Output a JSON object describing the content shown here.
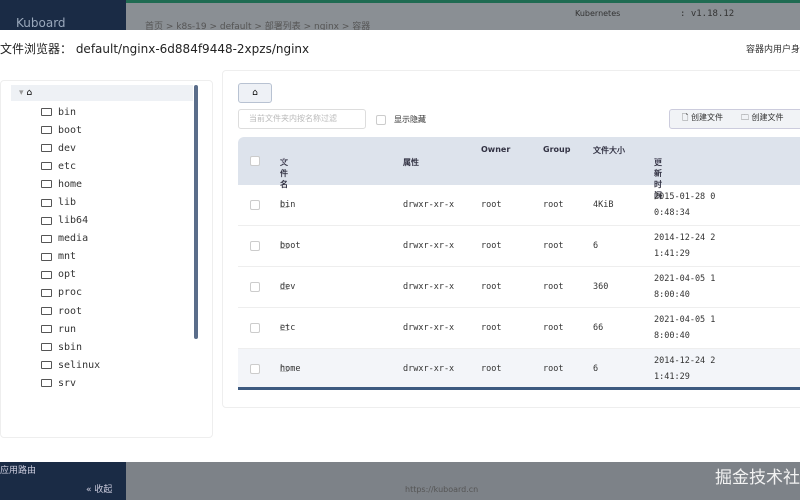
{
  "background": {
    "brand": "Kuboard",
    "breadcrumb": "首页 > k8s-19 > default > 部署列表 > nginx > 容器",
    "versions": [
      {
        "label": "Kubernetes",
        "value": ": v1.18.12"
      }
    ],
    "sidebar_item": "应用路由",
    "collapse": "« 收起",
    "url": "https://kuboard.cn",
    "watermark": "掘金技术社"
  },
  "dialog": {
    "title": "文件浏览器： default/nginx-6d884f9448-2xpzs/nginx",
    "right_label": "容器内用户身"
  },
  "tree": {
    "items": [
      "bin",
      "boot",
      "dev",
      "etc",
      "home",
      "lib",
      "lib64",
      "media",
      "mnt",
      "opt",
      "proc",
      "root",
      "run",
      "sbin",
      "selinux",
      "srv"
    ]
  },
  "toolbar": {
    "search_placeholder": "当前文件夹内按名称过滤",
    "show_hidden": "显示隐藏",
    "create_file": "创建文件",
    "create_folder": "创建文件"
  },
  "table": {
    "headers": {
      "name": "文件名",
      "attr": "属性",
      "owner": "Owner",
      "group": "Group",
      "size": "文件大小",
      "mtime": "更新时间"
    },
    "rows": [
      {
        "name": "bin",
        "attr": "drwxr-xr-x",
        "owner": "root",
        "group": "root",
        "size": "4KiB",
        "t1": "2015-01-28 0",
        "t2": "0:48:34"
      },
      {
        "name": "boot",
        "attr": "drwxr-xr-x",
        "owner": "root",
        "group": "root",
        "size": "6",
        "t1": "2014-12-24 2",
        "t2": "1:41:29"
      },
      {
        "name": "dev",
        "attr": "drwxr-xr-x",
        "owner": "root",
        "group": "root",
        "size": "360",
        "t1": "2021-04-05 1",
        "t2": "8:00:40"
      },
      {
        "name": "etc",
        "attr": "drwxr-xr-x",
        "owner": "root",
        "group": "root",
        "size": "66",
        "t1": "2021-04-05 1",
        "t2": "8:00:40"
      },
      {
        "name": "home",
        "attr": "drwxr-xr-x",
        "owner": "root",
        "group": "root",
        "size": "6",
        "t1": "2014-12-24 2",
        "t2": "1:41:29"
      }
    ]
  }
}
